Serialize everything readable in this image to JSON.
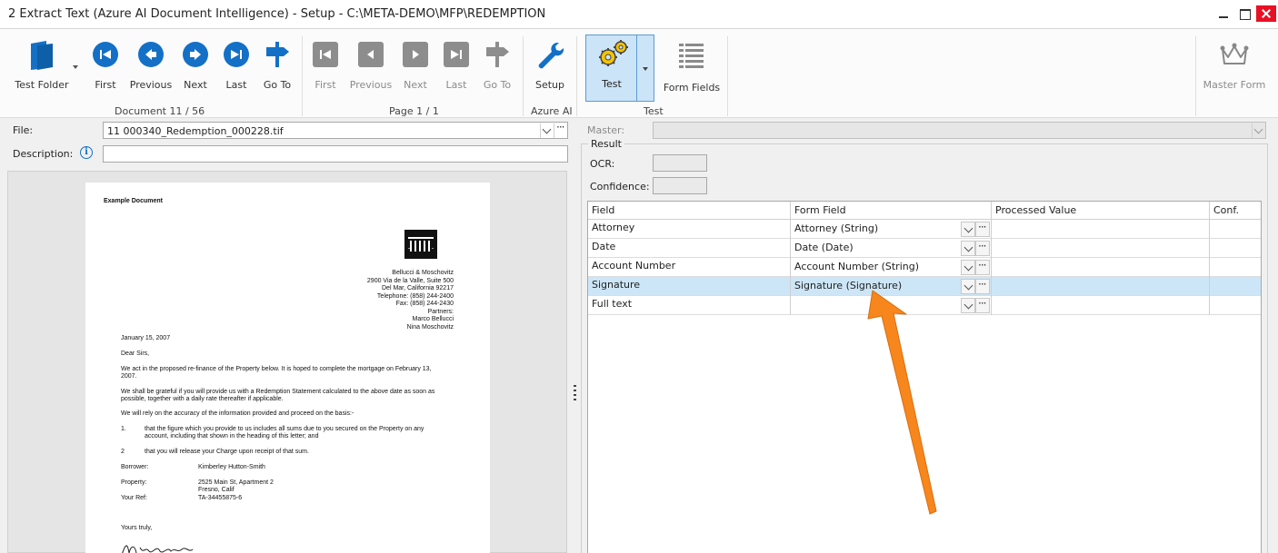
{
  "window": {
    "title": "2 Extract Text (Azure AI Document Intelligence) - Setup - C:\\META-DEMO\\MFP\\REDEMPTION"
  },
  "ribbon": {
    "test_folder": "Test Folder",
    "doc_nav": {
      "first": "First",
      "previous": "Previous",
      "next": "Next",
      "last": "Last",
      "goto": "Go To"
    },
    "page_nav": {
      "first": "First",
      "previous": "Previous",
      "next": "Next",
      "last": "Last",
      "goto": "Go To"
    },
    "setup": "Setup",
    "test": "Test",
    "form_fields": "Form Fields",
    "master_form": "Master Form",
    "groups": {
      "document": "Document 11 / 56",
      "page": "Page 1 / 1",
      "azure": "Azure AI",
      "test": "Test"
    }
  },
  "left": {
    "file_label": "File:",
    "file_value": "11 000340_Redemption_000228.tif",
    "description_label": "Description:",
    "description_value": "",
    "info_icon": "i"
  },
  "document": {
    "heading": "Example Document",
    "address": [
      "Bellucci & Moschovitz",
      "2900 Via de la Valle, Suite 500",
      "Del Mar, California 92217",
      "Telephone:  (858) 244-2400",
      "Fax:  (858) 244-2430",
      "Partners:",
      "Marco Bellucci",
      "Nina Moschovitz"
    ],
    "date": "January 15, 2007",
    "greeting": "Dear Sirs,",
    "para1": [
      "We act in the proposed re-finance of the Property below.  It is hoped to complete the mortgage on February 13,",
      "2007."
    ],
    "para2": [
      "We shall be grateful if you will provide us with a Redemption Statement calculated to the above date as soon as",
      "possible, together with a daily rate thereafter if applicable."
    ],
    "para3": "We will rely on the accuracy of the information provided and proceed on the basis:-",
    "item1_num": "1.",
    "item1": [
      "that the figure which you provide to us includes all sums due to you secured on the Property on any",
      "account, including that shown in the heading of this letter; and"
    ],
    "item2_num": "2",
    "item2": "that you will release your Charge upon receipt of that sum.",
    "borrower_label": "Borrower:",
    "borrower": "Kimberley Hutton-Smith",
    "property_label": "Property:",
    "property": [
      "2525 Main St, Apartment 2",
      "Fresno, Calif"
    ],
    "ref_label": "Your Ref:",
    "ref": "TA-34455875-6",
    "closing": "Yours truly,"
  },
  "right": {
    "master_label": "Master:",
    "master_value": "",
    "result_label": "Result",
    "ocr_label": "OCR:",
    "confidence_label": "Confidence:",
    "grid": {
      "headers": [
        "Field",
        "Form Field",
        "Processed Value",
        "Conf."
      ],
      "rows": [
        {
          "field": "Attorney",
          "form_field": "Attorney (String)",
          "processed": "",
          "conf": ""
        },
        {
          "field": "Date",
          "form_field": "Date (Date)",
          "processed": "",
          "conf": ""
        },
        {
          "field": "Account Number",
          "form_field": "Account Number (String)",
          "processed": "",
          "conf": ""
        },
        {
          "field": "Signature",
          "form_field": "Signature (Signature)",
          "processed": "",
          "conf": ""
        },
        {
          "field": "Full text",
          "form_field": "",
          "processed": "",
          "conf": ""
        }
      ],
      "selected_row": 3
    }
  },
  "colors": {
    "accent": "#1370c6",
    "selection": "#cde6f7",
    "annotation_arrow": "#f7861c",
    "close": "#e81123"
  }
}
